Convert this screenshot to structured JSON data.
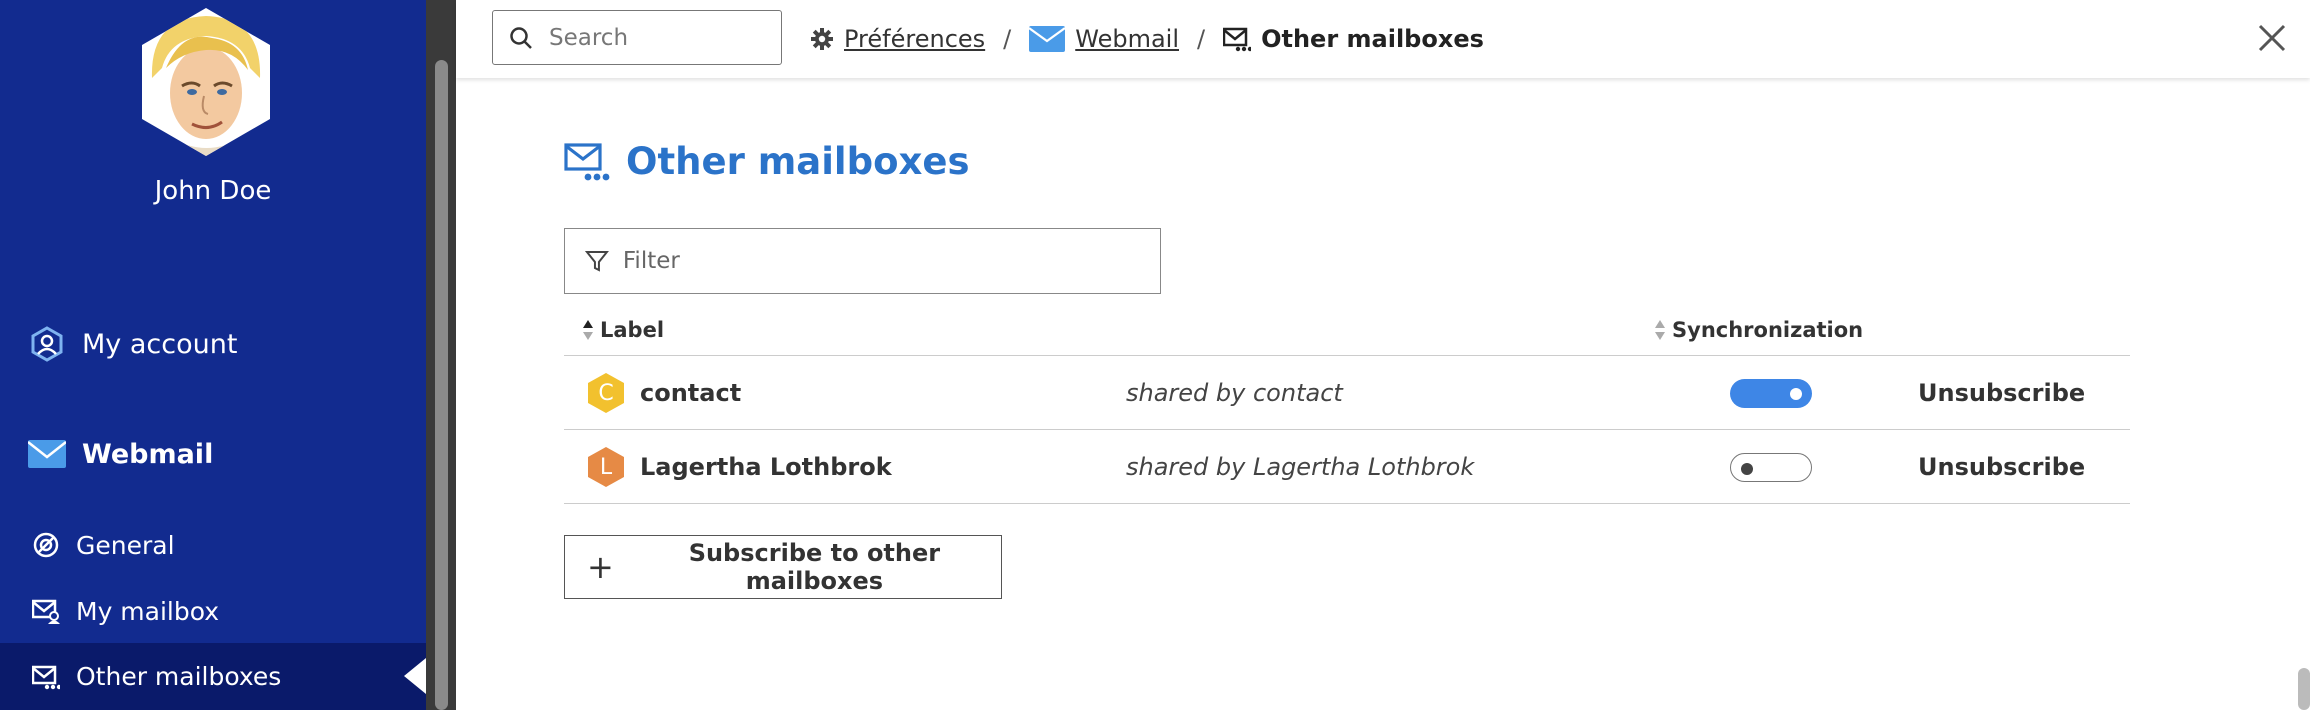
{
  "sidebar": {
    "user_name": "John Doe",
    "items": [
      {
        "label": "My account",
        "icon": "my-account-icon"
      },
      {
        "label": "Webmail",
        "icon": "envelope-icon"
      },
      {
        "label": "General",
        "icon": "general-icon"
      },
      {
        "label": "My mailbox",
        "icon": "my-mailbox-icon"
      },
      {
        "label": "Other mailboxes",
        "icon": "other-mailboxes-icon",
        "active": true
      }
    ],
    "bg_color": "#122b8f",
    "active_bg_color": "#0a1a6a"
  },
  "topbar": {
    "search_placeholder": "Search",
    "breadcrumb": {
      "preferences": "Préférences",
      "webmail": "Webmail",
      "current": "Other mailboxes",
      "separator": "/"
    }
  },
  "main": {
    "title": "Other mailboxes",
    "title_color": "#2b73c9",
    "filter_placeholder": "Filter",
    "columns": {
      "label": "Label",
      "sync": "Synchronization"
    },
    "rows": [
      {
        "initial": "C",
        "name": "contact",
        "shared": "shared by contact",
        "sync": true,
        "action": "Unsubscribe",
        "badge_color": "#f2c12e"
      },
      {
        "initial": "L",
        "name": "Lagertha Lothbrok",
        "shared": "shared by Lagertha Lothbrok",
        "sync": false,
        "action": "Unsubscribe",
        "badge_color": "#e68a45"
      }
    ],
    "subscribe_button": "Subscribe to other mailboxes"
  }
}
